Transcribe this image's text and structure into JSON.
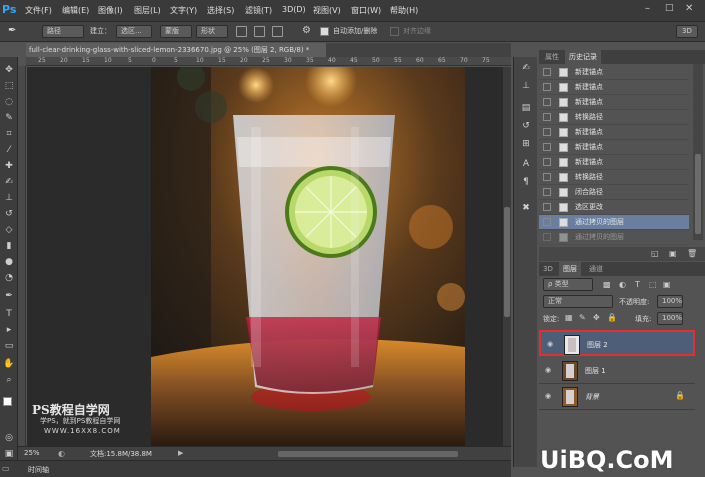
{
  "app": {
    "logo": "Ps"
  },
  "menu": [
    "文件(F)",
    "编辑(E)",
    "图像(I)",
    "图层(L)",
    "文字(Y)",
    "选择(S)",
    "滤镜(T)",
    "3D(D)",
    "视图(V)",
    "窗口(W)",
    "帮助(H)"
  ],
  "options": {
    "path_mode": "路径",
    "build_label": "建立：",
    "selection_btn": "选区...",
    "mask_btn": "蒙版",
    "shape_btn": "形状",
    "auto_add_label": "自动添加/删除",
    "align_edges_label": "对齐边缘",
    "mode_3d": "3D"
  },
  "document": {
    "tab_title": "full-clear-drinking-glass-with-sliced-lemon-2336670.jpg @ 25% (图层 2, RGB/8) *"
  },
  "ruler": {
    "top": [
      "25",
      "20",
      "15",
      "10",
      "5",
      "0",
      "5",
      "10",
      "15",
      "20",
      "25",
      "30",
      "35",
      "40",
      "45",
      "50",
      "55",
      "60",
      "65",
      "70",
      "75"
    ]
  },
  "status": {
    "zoom": "25%",
    "doc_info": "文档:15.8M/38.8M"
  },
  "timeline": {
    "label": "时间轴"
  },
  "history": {
    "tabs": [
      "属性",
      "历史记录"
    ],
    "items": [
      "新建锚点",
      "新建锚点",
      "新建锚点",
      "转换路径",
      "新建锚点",
      "新建锚点",
      "新建锚点",
      "转换路径",
      "闭合路径",
      "选区更改",
      "通过拷贝的图层",
      "通过拷贝的图层"
    ]
  },
  "layers": {
    "tabs": [
      "3D",
      "图层",
      "通道"
    ],
    "filter_label": "ρ 类型",
    "blend_mode": "正常",
    "opacity_label": "不透明度:",
    "opacity_value": "100%",
    "lock_label": "锁定:",
    "fill_label": "填充:",
    "fill_value": "100%",
    "rows": [
      {
        "name": "图层 2"
      },
      {
        "name": "图层 1"
      },
      {
        "name": "背景"
      }
    ]
  },
  "watermark": {
    "ps_title": "PS教程自学网",
    "ps_sub": "学PS，就到PS教程自学网",
    "ps_url": "WWW.16XX8.COM",
    "uibq": "UiBQ.CoM"
  },
  "colors": {
    "accent": "#31a8ff",
    "layer_highlight": "#e03030",
    "selected_row": "#6a7fa0"
  }
}
